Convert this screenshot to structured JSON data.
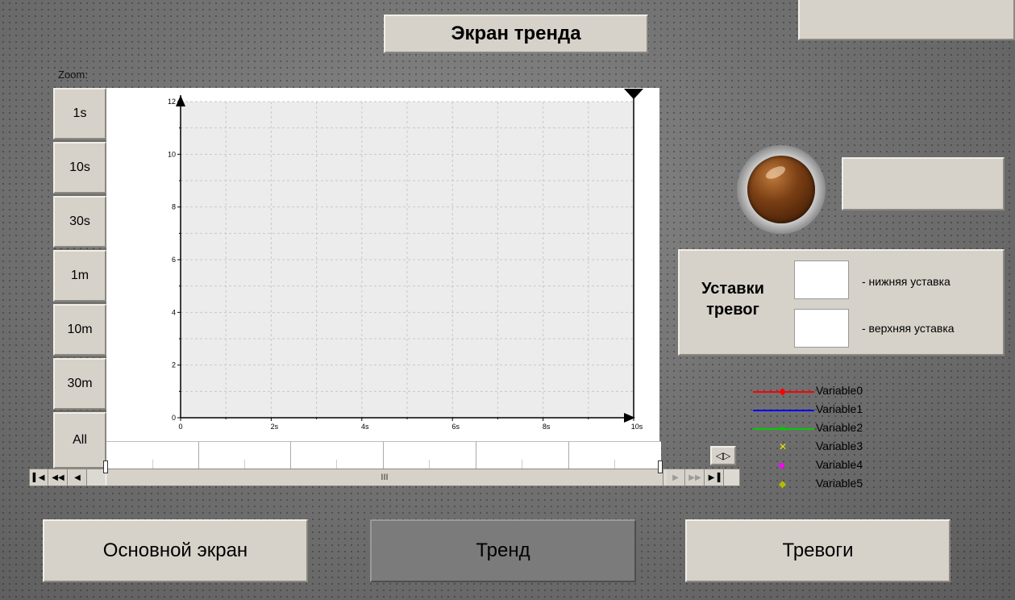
{
  "header": {
    "title": "Экран тренда"
  },
  "zoom": {
    "label": "Zoom:",
    "buttons": [
      "1s",
      "10s",
      "30s",
      "1m",
      "10m",
      "30m",
      "All"
    ]
  },
  "chart_data": {
    "type": "line",
    "y_ticks": [
      "0",
      "2",
      "4",
      "6",
      "8",
      "10",
      "12"
    ],
    "x_ticks": [
      "0",
      "2s",
      "4s",
      "6s",
      "8s",
      "10s"
    ],
    "ylim": [
      0,
      12
    ],
    "xlim": [
      0,
      10
    ],
    "grid": true,
    "series": []
  },
  "scrollbar": {
    "thumb_grip": "III"
  },
  "alarm": {
    "title_line1": "Уставки",
    "title_line2": "тревог",
    "low_label": "- нижняя уставка",
    "high_label": "- верхняя уставка",
    "low_value": "",
    "high_value": ""
  },
  "legend": [
    {
      "name": "Variable0",
      "color": "#ff0000",
      "marker": "diamond",
      "line": true
    },
    {
      "name": "Variable1",
      "color": "#0000ff",
      "marker": "none",
      "line": true
    },
    {
      "name": "Variable2",
      "color": "#00cc00",
      "marker": "cross",
      "line": true
    },
    {
      "name": "Variable3",
      "color": "#e6e600",
      "marker": "x",
      "line": false
    },
    {
      "name": "Variable4",
      "color": "#ff00ff",
      "marker": "square",
      "line": false
    },
    {
      "name": "Variable5",
      "color": "#b8b800",
      "marker": "diamond",
      "line": false
    }
  ],
  "nav": {
    "main": "Основной экран",
    "trend": "Тренд",
    "alarms": "Тревоги"
  }
}
